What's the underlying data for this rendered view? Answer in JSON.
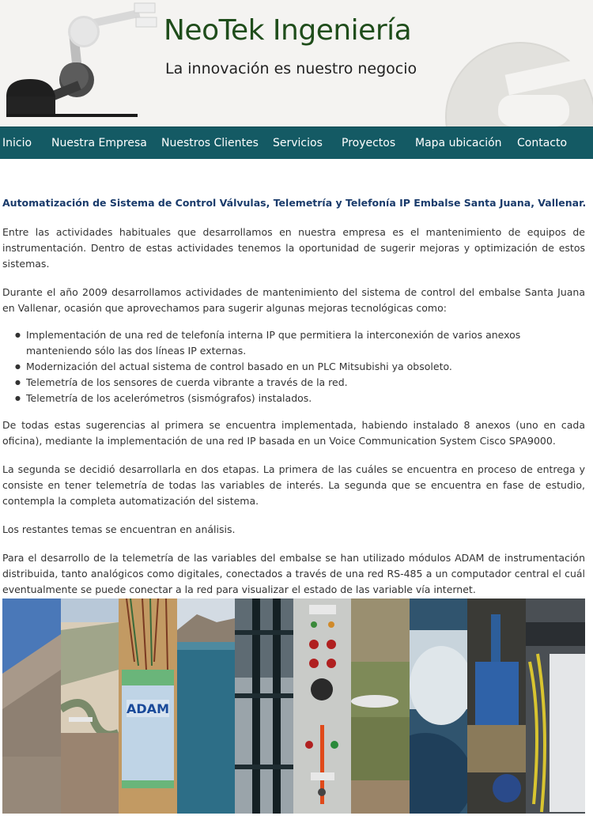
{
  "header": {
    "title": "NeoTek Ingeniería",
    "tagline": "La innovación es nuestro negocio"
  },
  "nav": {
    "items": [
      {
        "label": "Inicio"
      },
      {
        "label": "Nuestra Empresa"
      },
      {
        "label": "Nuestros Clientes"
      },
      {
        "label": "Servicios"
      },
      {
        "label": "Proyectos"
      },
      {
        "label": "Mapa ubicación"
      },
      {
        "label": "Contacto"
      }
    ]
  },
  "article": {
    "heading": "Automatización de Sistema de Control Válvulas, Telemetría y Telefonía IP Embalse Santa Juana, Vallenar.",
    "p1": "Entre las actividades habituales que desarrollamos en nuestra empresa es el mantenimiento de equipos de instrumentación. Dentro de estas actividades tenemos la oportunidad de sugerir mejoras y optimización de estos sistemas.",
    "p2": "Durante el año 2009 desarrollamos actividades de mantenimiento del sistema de control del embalse Santa Juana en Vallenar, ocasión que aprovechamos para sugerir algunas mejoras tecnológicas como:",
    "bullets": [
      "Implementación de una red de telefonía interna IP que permitiera la interconexión de varios anexos manteniendo sólo las dos líneas IP externas.",
      "Modernización del actual sistema de control basado en un PLC Mitsubishi ya obsoleto.",
      "Telemetría de los sensores de cuerda vibrante a través de la red.",
      "Telemetría de los acelerómetros (sismógrafos) instalados."
    ],
    "p3": "De todas estas sugerencias al primera se encuentra implementada, habiendo instalado 8 anexos (uno en cada oficina), mediante la implementación de una red IP basada en un Voice Communication System Cisco SPA9000.",
    "p4": "La segunda se decidió desarrollarla en dos etapas. La primera de las cuáles se encuentra en proceso de entrega y consiste en tener telemetría de todas las variables de interés. La segunda que se encuentra en fase de estudio, contempla la completa automatización del sistema.",
    "p5": "Los restantes temas se encuentran en análisis.",
    "p6": "Para el desarrollo de la telemetría de las variables del embalse se han utilizado módulos ADAM de instrumentación distribuida, tanto analógicos como digitales, conectados a través de una red RS-485 a un computador central el cuál eventualmente se puede conectar a la red para visualizar el estado de las variable vía internet."
  },
  "photos": {
    "adam_label": "ADAM"
  },
  "colors": {
    "nav_bg": "#145a64",
    "title": "#1f4d1b",
    "heading": "#1a3b6b"
  }
}
